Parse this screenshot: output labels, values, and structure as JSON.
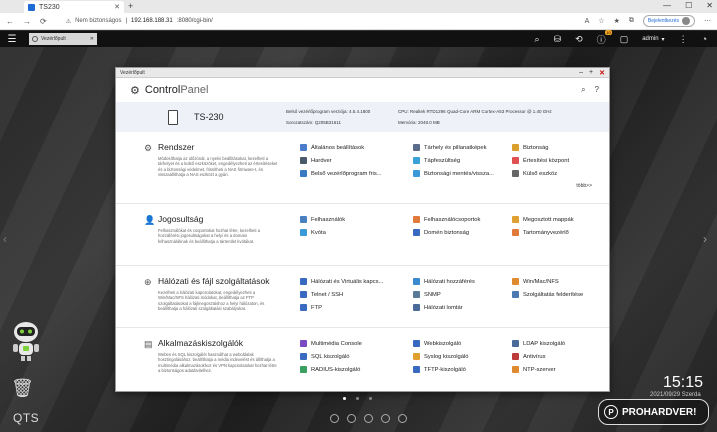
{
  "browser": {
    "tab_title": "TS230",
    "url_warning": "Nem biztonságos",
    "url_host": "192.168.188.31",
    "url_rest": ":8080/cgi-bin/",
    "signin_label": "Bejelentkezés"
  },
  "qts_bar": {
    "tab_label": "Vezérlőpult",
    "user": "admin",
    "notif_badge": "10"
  },
  "window": {
    "title": "Vezérlőpult",
    "app_title_strong": "Control",
    "app_title_light": "Panel"
  },
  "device": {
    "name": "TS-230",
    "firmware": "Belső vezérlőprogram verziója: 4.5.4.1800",
    "serial": "Sorozatszám: Q205B31611",
    "cpu": "CPU: Realtek RTD1296 Quad-Core ARM Cortex-A53 Processor @ 1.40 GHz",
    "memory": "Memória: 2048.0 MB"
  },
  "sections": [
    {
      "title": "Rendszer",
      "icon": "gear-icon",
      "desc": "Módosíthatja az időzónát, a nyelvi beállításokat, kezelheti a tárhelyet és a külső eszközöket, engedélyezheti az értesítéseket és a biztonsági védelmet, frissítheti a NAS firmware-t, és visszaállíthatja a NAS eszközt a gyári.",
      "items": [
        {
          "label": "Általános beállítások",
          "color": "#4a7cc9"
        },
        {
          "label": "Tárhely és pillanatképek",
          "color": "#5b6b8a"
        },
        {
          "label": "Biztonság",
          "color": "#d9a02b"
        },
        {
          "label": "Hardver",
          "color": "#4a5a6a"
        },
        {
          "label": "Tápfeszültség",
          "color": "#3aa0d8"
        },
        {
          "label": "Értesítési központ",
          "color": "#e05050"
        },
        {
          "label": "Belső vezérlőprogram fris...",
          "color": "#3a7ac0"
        },
        {
          "label": "Biztonsági mentés/vissza...",
          "color": "#3a9ad8"
        },
        {
          "label": "Külső eszköz",
          "color": "#666666"
        }
      ],
      "more": "több>>"
    },
    {
      "title": "Jogosultság",
      "icon": "user-lock-icon",
      "desc": "Felhasználókat és csoportokat hozhat létre, kezelheti a hozzáférési jogosultságokat a helyi és a domain felhasználóknak és beállíthatja a tárterület kvótákat.",
      "items": [
        {
          "label": "Felhasználók",
          "color": "#4a80c0"
        },
        {
          "label": "Felhasználócsoportok",
          "color": "#e07a3a"
        },
        {
          "label": "Megosztott mappák",
          "color": "#e0a030"
        },
        {
          "label": "Kvóta",
          "color": "#3a9ad8"
        },
        {
          "label": "Domén biztonság",
          "color": "#3a6ac0"
        },
        {
          "label": "Tartományvezérlő",
          "color": "#e07a3a"
        }
      ]
    },
    {
      "title": "Hálózati és fájl szolgáltatások",
      "icon": "globe-icon",
      "desc": "Kezelheti a hálózati kapcsolatokat, engedélyezheti a Win/Mac/NFS hálózati módokat, beállíthatja az FTP szolgáltatásokat a fájlmegosztáshoz a helyi hálózaton, és beállíthatja a hálózati szolgáltatási szabályokat.",
      "items": [
        {
          "label": "Hálózati és Virtuális kapcs...",
          "color": "#3a6ac0"
        },
        {
          "label": "Hálózati hozzáférés",
          "color": "#3a8ad0"
        },
        {
          "label": "Win/Mac/NFS",
          "color": "#e08a30"
        },
        {
          "label": "Telnet / SSH",
          "color": "#3a6ac0"
        },
        {
          "label": "SNMP",
          "color": "#5a7a9a"
        },
        {
          "label": "Szolgáltatás felderítése",
          "color": "#4a7ab0"
        },
        {
          "label": "FTP",
          "color": "#3a6ac0"
        },
        {
          "label": "Hálózati lomtár",
          "color": "#4a6a9a"
        }
      ]
    },
    {
      "title": "Alkalmazáskiszolgálók",
      "icon": "server-icon",
      "desc": "Webes és SQL kiszolgálót használhat a weboldalak hosztingolásához, beállíthatja a média indexelést és állíthatja a multimédia alkalmazásokhoz és VPN kapcsolatokat hozhat létre a biztonságos adatátvitelhez.",
      "items": [
        {
          "label": "Multimédia Console",
          "color": "#7a4ac0"
        },
        {
          "label": "Webkiszolgáló",
          "color": "#3a6ac0"
        },
        {
          "label": "LDAP kiszolgáló",
          "color": "#4a6a9a"
        },
        {
          "label": "SQL kiszolgáló",
          "color": "#3a6ac0"
        },
        {
          "label": "Syslog kiszolgáló",
          "color": "#e0a030"
        },
        {
          "label": "Antivírus",
          "color": "#c03a3a"
        },
        {
          "label": "RADIUS-kiszolgáló",
          "color": "#3aa060"
        },
        {
          "label": "TFTP-kiszolgáló",
          "color": "#3a6ac0"
        },
        {
          "label": "NTP-szerver",
          "color": "#e08a30"
        }
      ]
    }
  ],
  "desktop": {
    "os_label": "QTS",
    "clock": "15:15",
    "date": "2021/09/29 Szerda",
    "watermark": "PROHARDVER!"
  }
}
